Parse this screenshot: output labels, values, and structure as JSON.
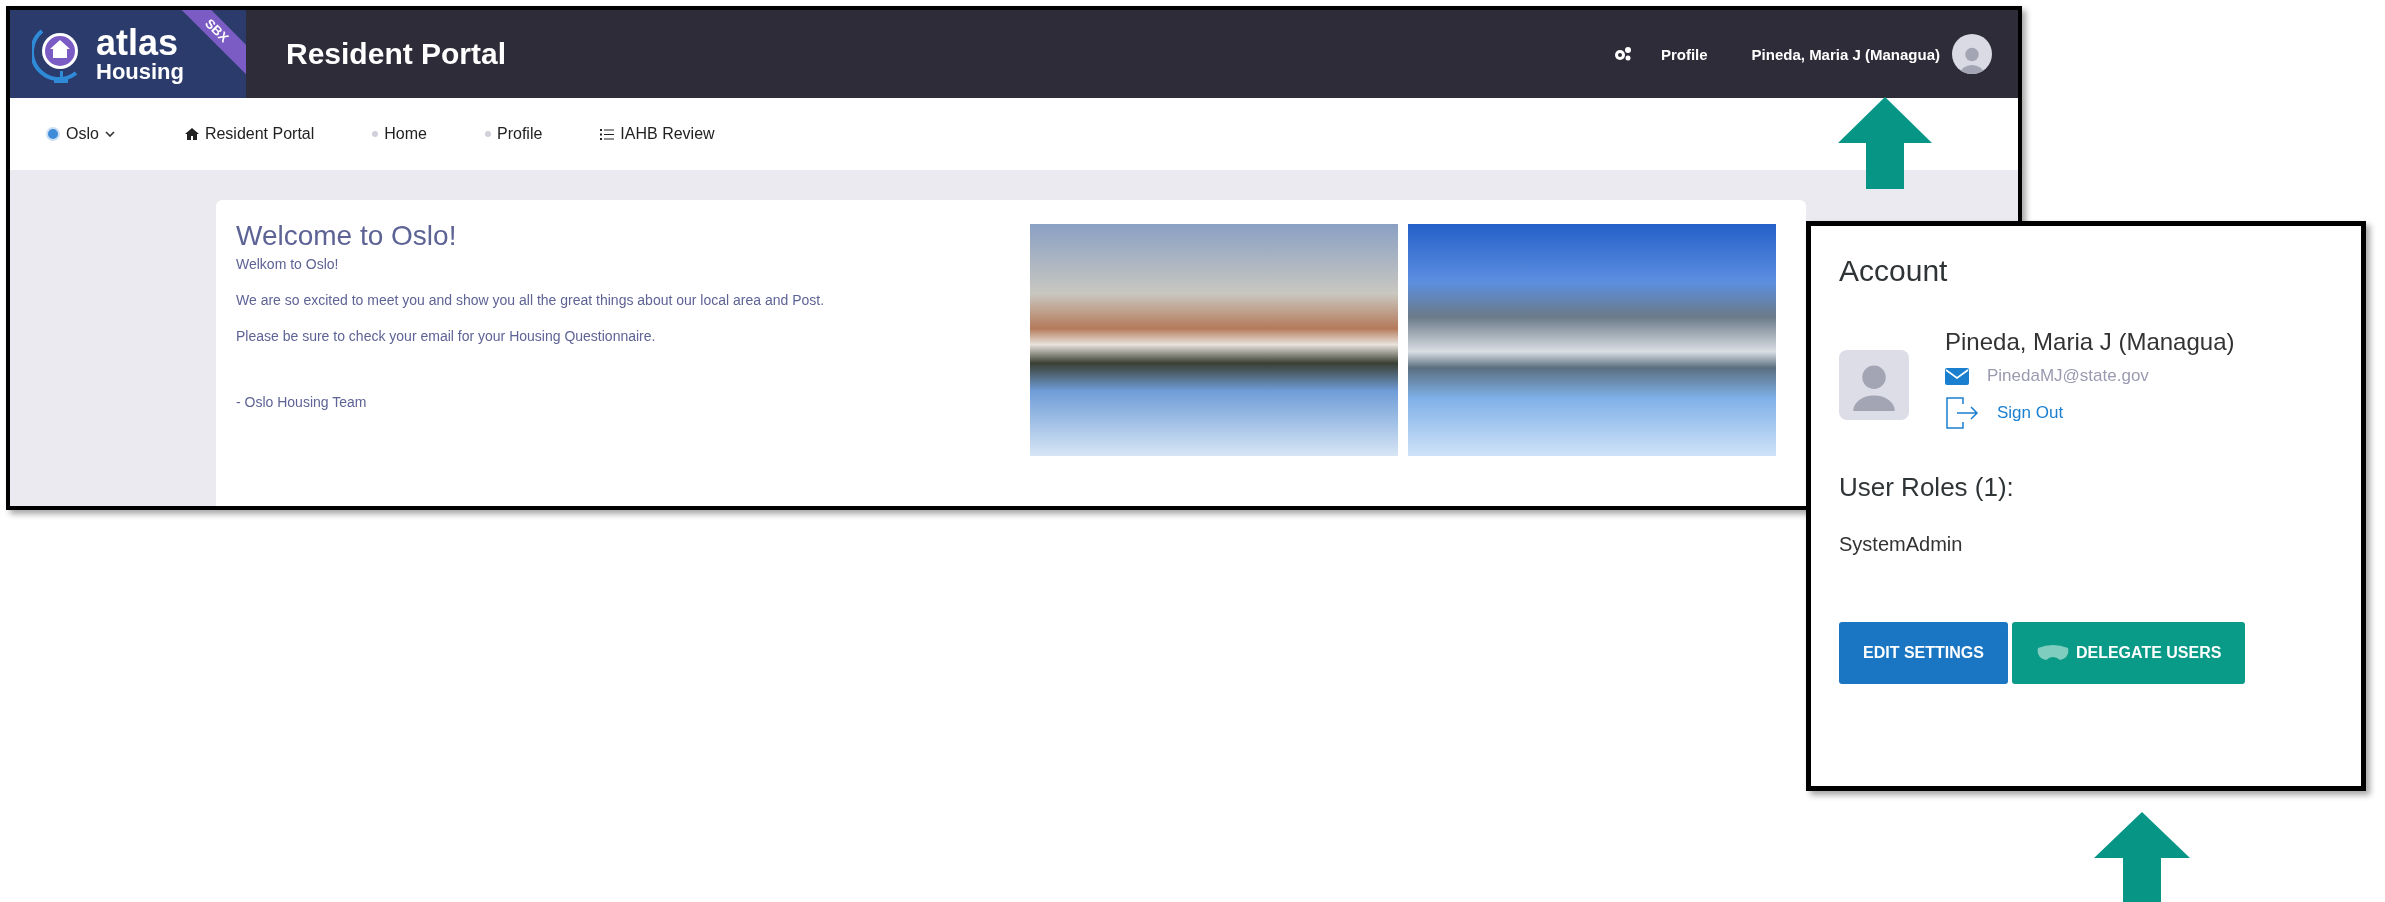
{
  "header": {
    "logo": {
      "line1": "atlas",
      "line2": "Housing",
      "ribbon": "SBX"
    },
    "title": "Resident Portal",
    "profile_link": "Profile",
    "user_name": "Pineda, Maria J (Managua)"
  },
  "nav": {
    "location": "Oslo",
    "items": [
      {
        "kind": "home",
        "label": "Resident Portal"
      },
      {
        "kind": "dot",
        "label": "Home"
      },
      {
        "kind": "dot",
        "label": "Profile"
      },
      {
        "kind": "list",
        "label": "IAHB Review"
      }
    ]
  },
  "welcome": {
    "title": "Welcome to Oslo!",
    "subtitle": "Welkom to Oslo!",
    "paragraphs": [
      "We are so excited to meet you and show you all the great things about our local area and Post.",
      "Please be sure to check your email for your Housing Questionnaire."
    ],
    "signature": "- Oslo Housing Team",
    "photos": [
      {
        "kind": "harbor"
      },
      {
        "kind": "skyline"
      }
    ]
  },
  "account": {
    "title": "Account",
    "name": "Pineda, Maria J (Managua)",
    "email": "PinedaMJ@state.gov",
    "sign_out": "Sign Out",
    "roles_title": "User Roles (1):",
    "roles": [
      "SystemAdmin"
    ],
    "buttons": [
      {
        "kind": "primary",
        "label": "EDIT SETTINGS"
      },
      {
        "kind": "delegate",
        "label": "DELEGATE USERS"
      }
    ]
  }
}
